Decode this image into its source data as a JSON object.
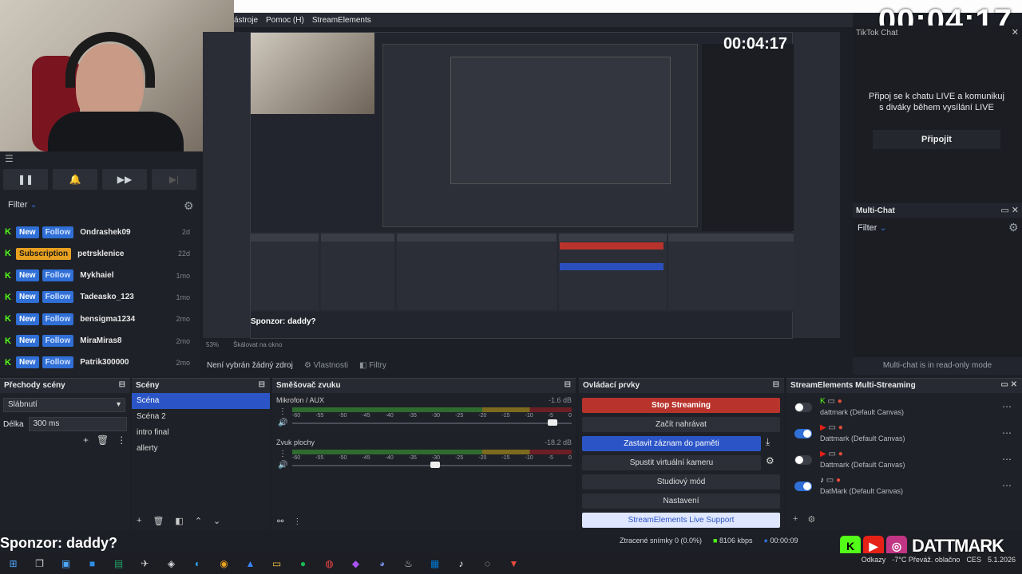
{
  "timer": "00:04:17",
  "menu": [
    "ástroje",
    "Pomoc (H)",
    "StreamElements"
  ],
  "activity": {
    "filter_label": "Filter",
    "items": [
      {
        "tag1": "New",
        "tag2": "Follow",
        "name": "Ondrashek09",
        "time": "2d"
      },
      {
        "tag1": "Subscription",
        "tag2": "",
        "name": "petrsklenice",
        "time": "22d"
      },
      {
        "tag1": "New",
        "tag2": "Follow",
        "name": "Mykhaiel",
        "time": "1mo"
      },
      {
        "tag1": "New",
        "tag2": "Follow",
        "name": "Tadeasko_123",
        "time": "1mo"
      },
      {
        "tag1": "New",
        "tag2": "Follow",
        "name": "bensigma1234",
        "time": "2mo"
      },
      {
        "tag1": "New",
        "tag2": "Follow",
        "name": "MiraMiras8",
        "time": "2mo"
      },
      {
        "tag1": "New",
        "tag2": "Follow",
        "name": "Patrik300000",
        "time": "2mo"
      }
    ]
  },
  "preview": {
    "inner_timer": "00:04:17",
    "sponsor_small": "Sponzor: daddy?",
    "zoom": "53%",
    "scale_label": "Škálovat na okno"
  },
  "source_bar": {
    "no_source": "Není vybrán žádný zdroj",
    "properties": "Vlastnosti",
    "filters": "Filtry"
  },
  "tiktok": {
    "title": "TikTok Chat",
    "message": "Připoj se k chatu LIVE a komunikuj s diváky během vysílání LIVE",
    "connect": "Připojit"
  },
  "multichat": {
    "title": "Multi-Chat",
    "filter": "Filter",
    "readonly": "Multi-chat is in read-only mode"
  },
  "transitions": {
    "title": "Přechody scény",
    "selected": "Slábnutí",
    "duration_label": "Délka",
    "duration": "300 ms"
  },
  "scenes": {
    "title": "Scény",
    "items": [
      "Scéna",
      "Scéna 2",
      "intro final",
      "allerty"
    ]
  },
  "mixer": {
    "title": "Směšovač zvuku",
    "channels": [
      {
        "name": "Mikrofon / AUX",
        "db": "-1.6 dB",
        "level": 0.93
      },
      {
        "name": "Zvuk plochy",
        "db": "-18.2 dB",
        "level": 0.51
      }
    ],
    "ticks": [
      "-60",
      "-55",
      "-50",
      "-45",
      "-40",
      "-35",
      "-30",
      "-25",
      "-20",
      "-15",
      "-10",
      "-5",
      "0"
    ]
  },
  "controls": {
    "title": "Ovládací prvky",
    "stop": "Stop Streaming",
    "record": "Začít nahrávat",
    "replay": "Zastavit záznam do paměti",
    "virtualcam": "Spustit virtuální kameru",
    "studio": "Studiový mód",
    "settings": "Nastavení",
    "support": "StreamElements Live Support"
  },
  "multistream": {
    "title": "StreamElements Multi-Streaming",
    "rows": [
      {
        "label": "dattmark (Default Canvas)",
        "on": false
      },
      {
        "label": "Dattmark (Default Canvas)",
        "on": true
      },
      {
        "label": "Dattmark (Default Canvas)",
        "on": false
      },
      {
        "label": "DatMark (Default Canvas)",
        "on": true
      }
    ]
  },
  "status": {
    "dropped": "Ztracené snímky 0 (0.0%)",
    "bitrate": "8106 kbps",
    "time": "00:00:09"
  },
  "sponsor": "Sponzor: daddy?",
  "brand": "DATTMARK",
  "tray": {
    "links": "Odkazy",
    "weather": "-7°C  Převáž. oblačno",
    "lang": "CES",
    "date": "5.1.2026"
  },
  "colors": {
    "accent": "#2b55c7",
    "stop": "#b8332c",
    "kick": "#53fc18"
  }
}
